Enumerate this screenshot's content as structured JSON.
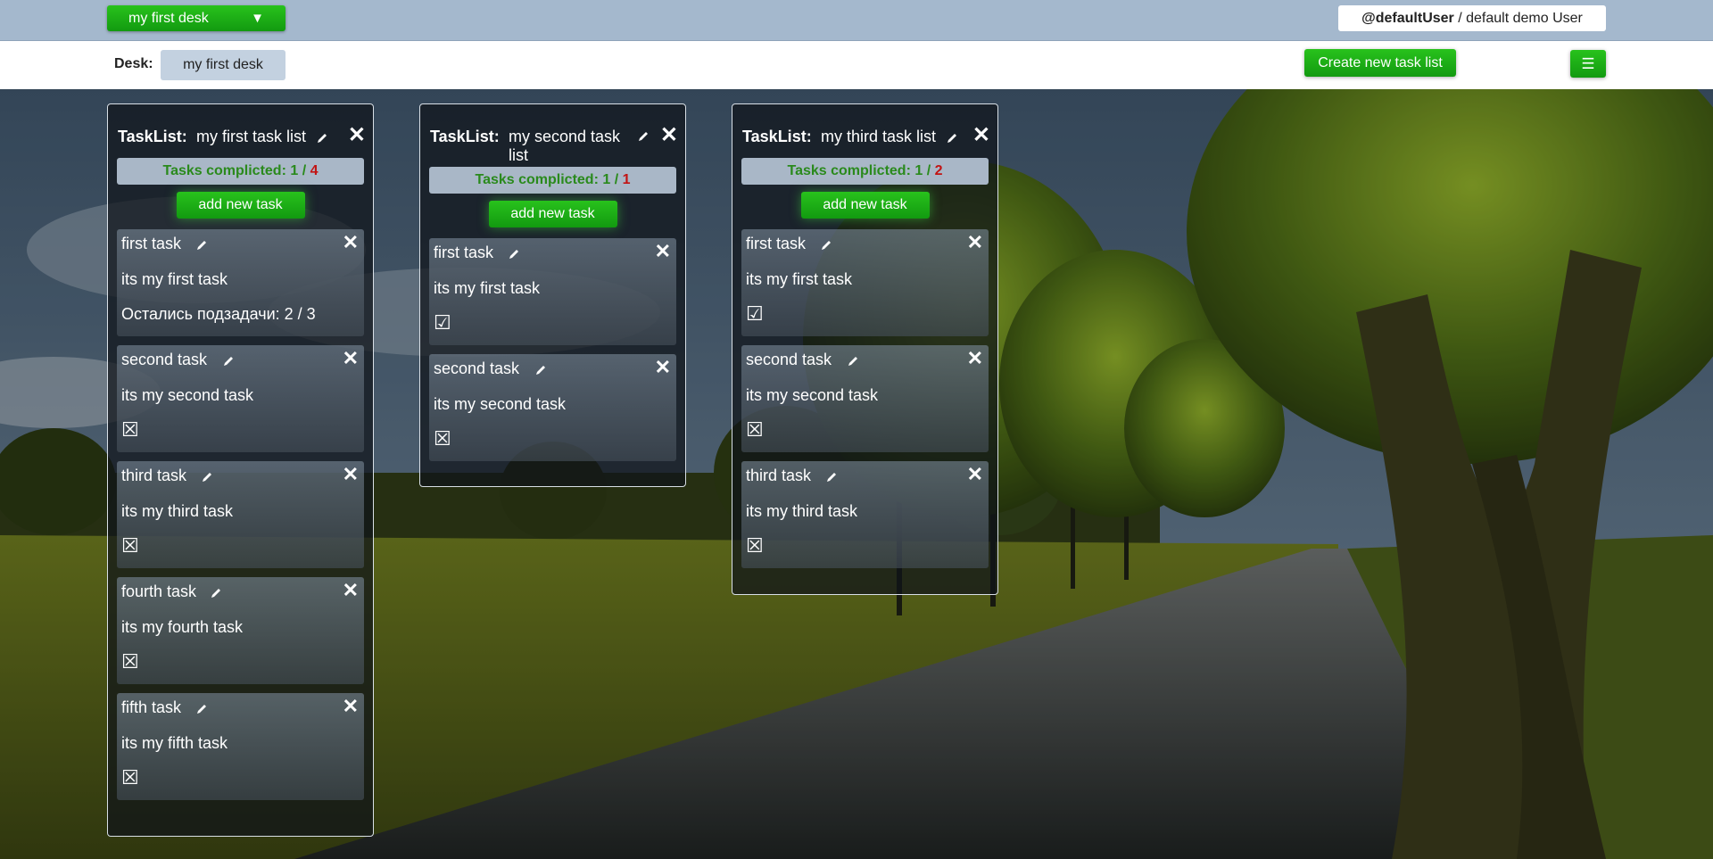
{
  "topbar": {
    "desk_selector": "my first desk",
    "user_handle": "@defaultUser",
    "user_sep": " / ",
    "user_name": "default demo User",
    "caret_icon": "triangle-down-icon"
  },
  "deskbar": {
    "desk_label": "Desk:",
    "desk_name": "my first desk",
    "create_button": "Create new task list",
    "menu_icon": "☰"
  },
  "colors": {
    "button_green": "#1fae15",
    "done_green": "#2a8a1c",
    "pending_red": "#c21313"
  },
  "tasklists": [
    {
      "label": "TaskList:",
      "name": "my first task list",
      "close": "✕",
      "stats_label": "Tasks complicted: ",
      "stats_done": "1",
      "stats_sep": " / ",
      "stats_total": "4",
      "add_button": "add new task",
      "tasks": [
        {
          "title": "first task",
          "desc": "its my first task",
          "extra": "Остались подзадачи: 2 / 3",
          "close": "✕"
        },
        {
          "title": "second task",
          "desc": "its my second task",
          "check": "☒",
          "close": "✕"
        },
        {
          "title": "third task",
          "desc": "its my third task",
          "check": "☒",
          "close": "✕"
        },
        {
          "title": "fourth task",
          "desc": "its my fourth task",
          "check": "☒",
          "close": "✕"
        },
        {
          "title": "fifth task",
          "desc": "its my fifth task",
          "check": "☒",
          "close": "✕"
        }
      ]
    },
    {
      "label": "TaskList:",
      "name": "my second task list",
      "close": "✕",
      "stats_label": "Tasks complicted: ",
      "stats_done": "1",
      "stats_sep": " / ",
      "stats_total": "1",
      "add_button": "add new task",
      "tasks": [
        {
          "title": "first task",
          "desc": "its my first task",
          "check": "☑",
          "close": "✕"
        },
        {
          "title": "second task",
          "desc": "its my second task",
          "check": "☒",
          "close": "✕"
        }
      ]
    },
    {
      "label": "TaskList:",
      "name": "my third task list",
      "close": "✕",
      "stats_label": "Tasks complicted: ",
      "stats_done": "1",
      "stats_sep": " / ",
      "stats_total": "2",
      "add_button": "add new task",
      "tasks": [
        {
          "title": "first task",
          "desc": "its my first task",
          "check": "☑",
          "close": "✕"
        },
        {
          "title": "second task",
          "desc": "its my second task",
          "check": "☒",
          "close": "✕"
        },
        {
          "title": "third task",
          "desc": "its my third task",
          "check": "☒",
          "close": "✕"
        }
      ]
    }
  ]
}
